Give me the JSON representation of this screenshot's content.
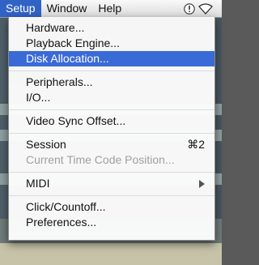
{
  "menubar": {
    "items": [
      "Setup",
      "Window",
      "Help"
    ],
    "active": "Setup",
    "icons": [
      "script-menu-icon",
      "wifi-icon"
    ]
  },
  "menu": {
    "items": [
      {
        "label": "Hardware..."
      },
      {
        "label": "Playback Engine..."
      },
      {
        "label": "Disk Allocation...",
        "state": "selected"
      },
      {
        "separator": true
      },
      {
        "label": "Peripherals..."
      },
      {
        "label": "I/O..."
      },
      {
        "separator": true
      },
      {
        "label": "Video Sync Offset..."
      },
      {
        "separator": true
      },
      {
        "label": "Session",
        "shortcut": "⌘2"
      },
      {
        "label": "Current Time Code Position...",
        "state": "disabled"
      },
      {
        "separator": true
      },
      {
        "label": "MIDI",
        "submenu": true
      },
      {
        "separator": true
      },
      {
        "label": "Click/Countoff..."
      },
      {
        "label": "Preferences..."
      }
    ]
  },
  "colors": {
    "menu_highlight": "#3a6ad6",
    "menubar_active": "#3163c4",
    "disabled_text": "#a0a0a0"
  }
}
